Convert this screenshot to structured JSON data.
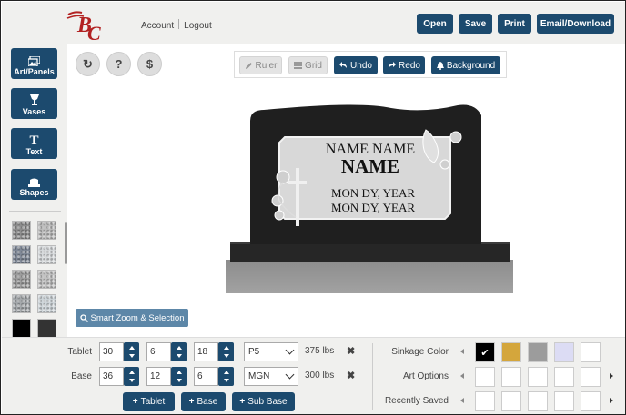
{
  "header": {
    "account_link": "Account",
    "logout_link": "Logout",
    "buttons": {
      "open": "Open",
      "save": "Save",
      "print": "Print",
      "email_download": "Email/Download"
    }
  },
  "sidebar": {
    "art_panels": "Art/Panels",
    "vases": "Vases",
    "text": "Text",
    "shapes": "Shapes",
    "swatches": [
      "granite-gray",
      "granite-light",
      "granite-blue",
      "granite-white",
      "granite-salt",
      "granite-pale",
      "granite-pepper",
      "granite-snow",
      "black",
      "charcoal"
    ],
    "swatch_colors": [
      "#8d8d8d",
      "#bdbdbd",
      "#7f8896",
      "#d7dadc",
      "#9c9c9c",
      "#c2c2c2",
      "#a4a8ab",
      "#cfd6da",
      "#000000",
      "#333333"
    ]
  },
  "canvas_tools": {
    "refresh": "↻",
    "help": "?",
    "price": "$"
  },
  "toolbar": {
    "ruler": "Ruler",
    "grid": "Grid",
    "undo": "Undo",
    "redo": "Redo",
    "background": "Background"
  },
  "monument": {
    "line1": "NAME NAME",
    "line2": "NAME",
    "line3": "MON DY, YEAR",
    "line4": "MON DY, YEAR"
  },
  "smart_zoom": "Smart Zoom & Selection",
  "dimensions": {
    "tablet": {
      "label": "Tablet",
      "w": "30",
      "d": "6",
      "h": "18",
      "finish": "P5",
      "weight": "375 lbs"
    },
    "base": {
      "label": "Base",
      "w": "36",
      "d": "12",
      "h": "6",
      "finish": "MGN",
      "weight": "300 lbs"
    }
  },
  "add_buttons": {
    "tablet": "Tablet",
    "base": "Base",
    "sub_base": "Sub Base"
  },
  "right_panel": {
    "sinkage_color": "Sinkage Color",
    "art_options": "Art Options",
    "recently_saved": "Recently Saved",
    "sinkage_swatches": [
      "#000000",
      "#d4a63c",
      "#9c9c9c",
      "#dcdcf4",
      "#ffffff"
    ]
  }
}
